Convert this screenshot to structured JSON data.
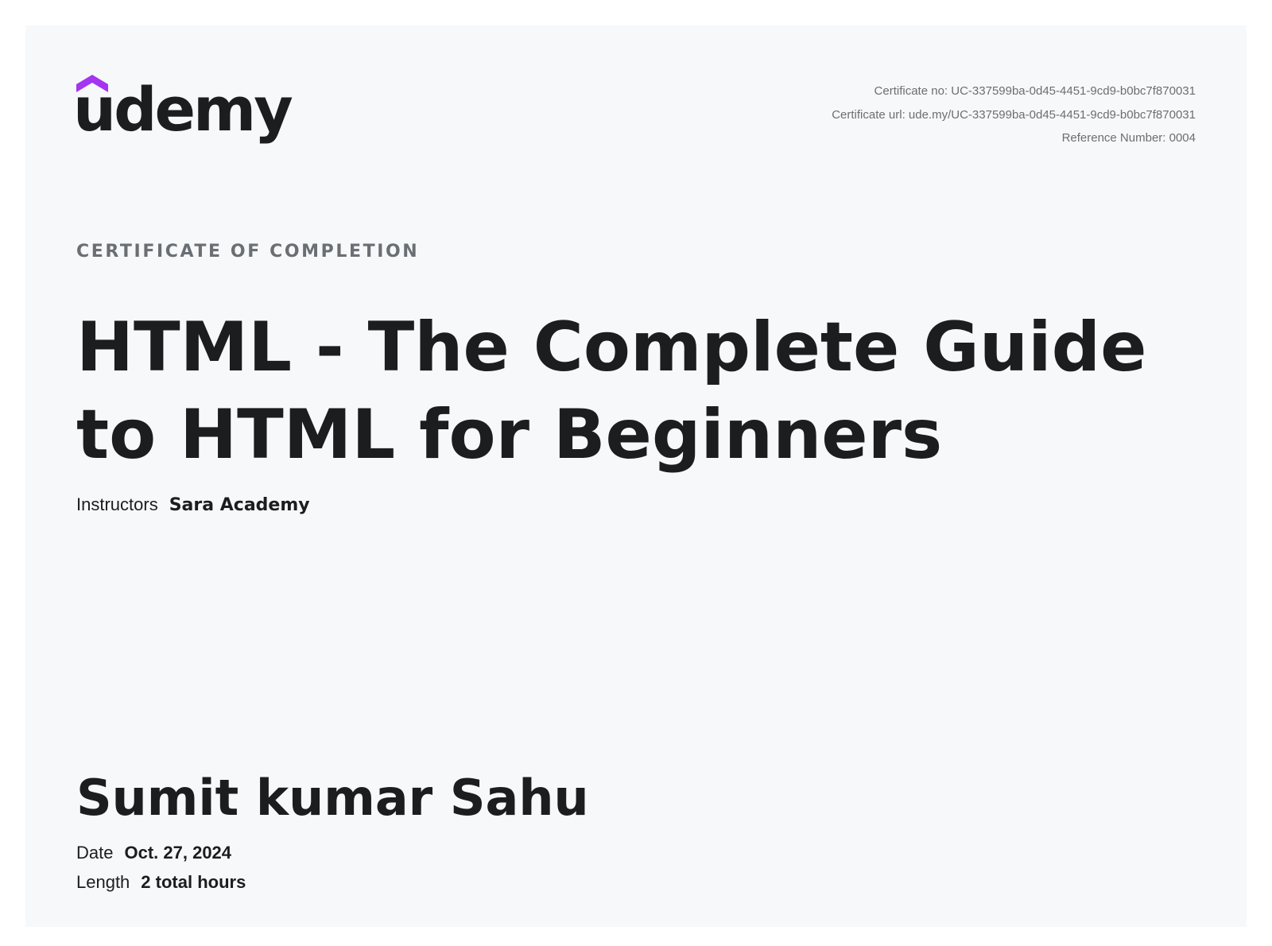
{
  "brand": {
    "logo_text": "udemy",
    "accent_color": "#a435f0"
  },
  "meta": {
    "certificate_no": "Certificate no: UC-337599ba-0d45-4451-9cd9-b0bc7f870031",
    "certificate_url": "Certificate url: ude.my/UC-337599ba-0d45-4451-9cd9-b0bc7f870031",
    "reference_number": "Reference Number: 0004"
  },
  "certificate": {
    "kicker": "CERTIFICATE OF COMPLETION",
    "course_title": "HTML - The Complete Guide to HTML for Beginners",
    "instructors_label": "Instructors",
    "instructors_value": "Sara Academy",
    "student_name": "Sumit kumar Sahu",
    "date_label": "Date",
    "date_value": "Oct. 27, 2024",
    "length_label": "Length",
    "length_value": "2 total hours"
  }
}
